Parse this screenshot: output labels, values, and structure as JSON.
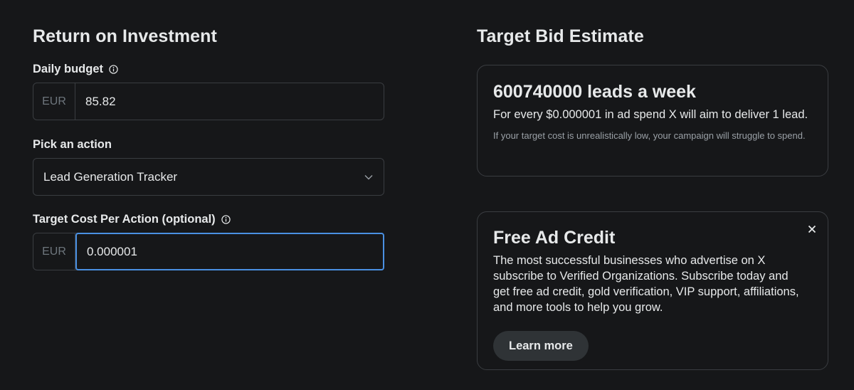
{
  "roi": {
    "title": "Return on Investment",
    "daily_budget": {
      "label": "Daily budget",
      "currency": "EUR",
      "value": "85.82"
    },
    "action": {
      "label": "Pick an action",
      "selected": "Lead Generation Tracker"
    },
    "target_cost": {
      "label": "Target Cost Per Action (optional)",
      "currency": "EUR",
      "value": "0.000001"
    }
  },
  "estimate": {
    "title": "Target Bid Estimate",
    "headline": "600740000 leads a week",
    "body": "For every $0.000001 in ad spend X will aim to deliver 1 lead.",
    "note": "If your target cost is unrealistically low, your campaign will struggle to spend."
  },
  "promo": {
    "title": "Free Ad Credit",
    "body": "The most successful businesses who advertise on X subscribe to Verified Organizations. Subscribe today and get free ad credit, gold verification, VIP support, affiliations, and more tools to help you grow.",
    "button_label": "Learn more"
  },
  "colors": {
    "background": "#161719",
    "border": "#3a3d41",
    "focus": "#4a90e2",
    "button": "#2f3336"
  },
  "icons": {
    "info": "info-icon",
    "chevron": "chevron-down-icon",
    "close": "close-icon"
  }
}
